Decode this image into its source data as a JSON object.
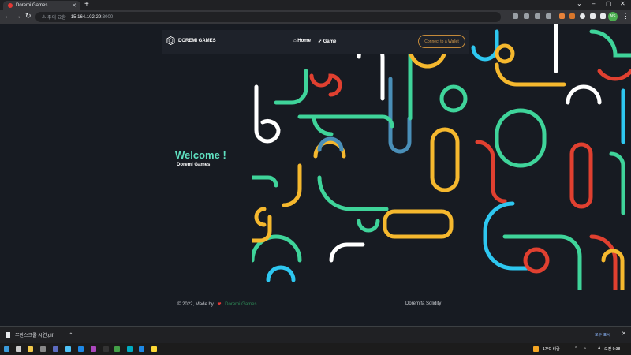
{
  "browser": {
    "tab_title": "Doremi Games",
    "new_tab_label": "+",
    "url_security": "주의 요함",
    "url_host": "15.164.102.29",
    "url_port": ":3000",
    "profile_initial": "NS"
  },
  "header": {
    "brand": "DOREMI GAMES",
    "nav": [
      {
        "label": "Home"
      },
      {
        "label": "Game"
      }
    ],
    "connect_label": "Connect to a Wallet"
  },
  "hero": {
    "title": "Welcome !",
    "subtitle": "Doremi Games"
  },
  "footer": {
    "copyright": "© 2022, Made by",
    "made_by_link": "Doremi Games",
    "right_text": "Doremifa Solidity"
  },
  "download_bar": {
    "file_name": "무한스크롤 시연.gif",
    "show_all": "모두 표시"
  },
  "taskbar": {
    "weather": "17°C 비람",
    "ime": "A",
    "clock": "오전 9:38"
  },
  "colors": {
    "background": "#171b22",
    "accent_teal": "#5fe0c0",
    "line_red": "#e04030",
    "line_yellow": "#f5b82e",
    "line_green": "#3fd49a",
    "line_cyan": "#2ec7f0",
    "line_white": "#ffffff",
    "line_steel": "#4a8fb8"
  }
}
